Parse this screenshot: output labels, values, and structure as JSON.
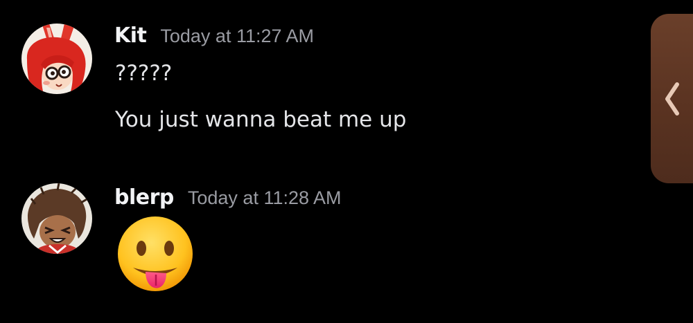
{
  "messages": [
    {
      "username": "Kit",
      "timestamp": "Today at 11:27 AM",
      "avatar_icon": "red-bunny-character-avatar-icon",
      "lines": [
        "?????",
        "You just wanna beat me up"
      ]
    },
    {
      "username": "blerp",
      "timestamp": "Today at 11:28 AM",
      "avatar_icon": "brown-haired-character-avatar-icon",
      "emoji": "face-with-tongue-emoji"
    }
  ],
  "side_panel": {
    "icon": "chevron-left-icon",
    "color": "#5a3321"
  },
  "colors": {
    "background": "#000000",
    "username": "#f2f3f5",
    "timestamp": "#9a9ca3",
    "message_text": "#e4e5e8"
  }
}
